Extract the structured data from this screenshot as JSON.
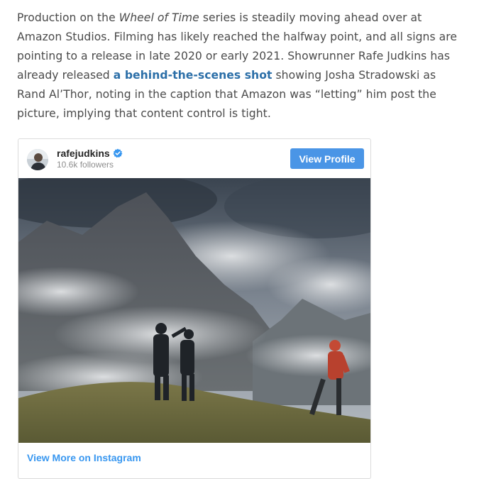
{
  "article": {
    "text_1": "Production on the ",
    "show_title": "Wheel of Time",
    "text_2": " series is steadily moving ahead over at Amazon Studios. Filming has likely reached the halfway point, and all signs are pointing to a release in late 2020 or early 2021. Showrunner Rafe Judkins has already released ",
    "link_text": "a behind-the-scenes shot",
    "text_3": " showing Josha Stradowski as Rand Al’Thor, noting in the caption that Amazon was “letting” him post the picture, implying that content control is tight."
  },
  "instagram_embed": {
    "username": "rafejudkins",
    "followers": "10.6k followers",
    "view_profile_label": "View Profile",
    "view_more_label": "View More on Instagram",
    "verified_icon": "verified-badge-icon"
  },
  "colors": {
    "link": "#2c6fa8",
    "button": "#4a95e6",
    "instagram_link": "#3897f0",
    "verified": "#3897f0"
  }
}
